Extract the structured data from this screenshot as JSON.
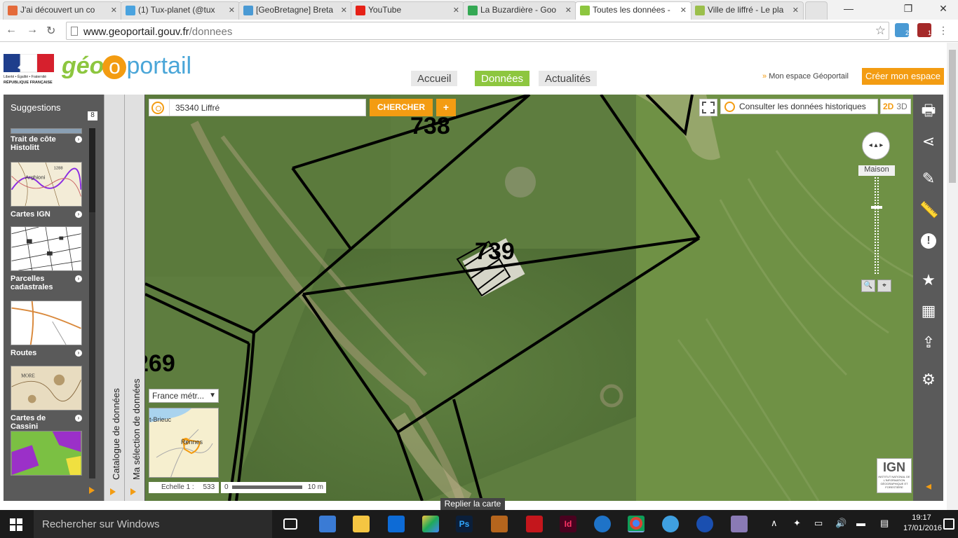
{
  "browser": {
    "tabs": [
      {
        "title": "J'ai découvert un co",
        "color": "#e46a3a"
      },
      {
        "title": "(1) Tux-planet (@tux",
        "color": "#4aa3df"
      },
      {
        "title": "[GeoBretagne] Breta",
        "color": "#4a9ad4"
      },
      {
        "title": "YouTube",
        "color": "#e62117"
      },
      {
        "title": "La Buzardière - Goo",
        "color": "#34a853"
      },
      {
        "title": "Toutes les données -",
        "color": "#8dc63f"
      },
      {
        "title": "Ville de liffré - Le pla",
        "color": "#9bbf4b"
      }
    ],
    "url_host": "www.geoportail.gouv.fr",
    "url_path": "/donnees",
    "window_minimize": "—",
    "window_maximize": "❐",
    "window_close": "✕",
    "close_tab": "✕",
    "back": "←",
    "forward": "→",
    "reload": "↻",
    "star": "☆",
    "extension_badges": [
      "2",
      "1"
    ]
  },
  "header": {
    "logo_geo": "géo",
    "logo_o": "o",
    "logo_portail": "portail",
    "rf_line1": "Liberté • Égalité • Fraternité",
    "rf_line2": "RÉPUBLIQUE FRANÇAISE",
    "nav": [
      "Accueil",
      "Données",
      "Actualités"
    ],
    "my_space": "Mon espace Géoportail",
    "my_space_arrow": "»",
    "create_space": "Créer mon espace"
  },
  "sidebar": {
    "title": "Suggestions",
    "count": "8",
    "items": [
      {
        "label": "Trait de côte Histolitt"
      },
      {
        "label": "Cartes IGN"
      },
      {
        "label": "Parcelles cadastrales"
      },
      {
        "label": "Routes"
      },
      {
        "label": "Cartes de Cassini"
      }
    ],
    "arrow": "›",
    "thumb_text": {
      "ign_1": "Arghioni",
      "ign_2": "1288",
      "cassini": "MORE"
    }
  },
  "vertical_tabs": {
    "catalog": "Catalogue de données",
    "selection": "Ma sélection de données"
  },
  "map": {
    "search_value": "35340 Liffré",
    "search_button": "CHERCHER",
    "plus_button": "+",
    "history_label": "Consulter les données historiques",
    "view_2d": "2D",
    "view_3d": "3D",
    "parcel_labels": [
      "738",
      "739",
      "269"
    ],
    "zoom_label": "Maison",
    "pan_glyph": "◂ ▴ ▸",
    "zoom_in_glyph": "🔍",
    "zoom_center_glyph": "⌖",
    "zoom_level": 0.3,
    "minimap_select": "France métr...",
    "minimap_select_caret": "▼",
    "minimap_labels": [
      "t-Brieuc",
      "Rennes"
    ],
    "scale_label": "Echelle 1 :",
    "scale_value": "533",
    "scale_zero": "0",
    "scale_end": "10 m",
    "ign_logo": "IGN",
    "ign_caption": "INSTITUT NATIONAL DE L'INFORMATION GÉOGRAPHIQUE ET FORESTIÈRE",
    "fold_label": "Replier la carte",
    "tools": [
      "print-icon",
      "share-icon",
      "pencil-icon",
      "ruler-icon",
      "alert-icon",
      "star-icon",
      "map-icon",
      "import-icon",
      "settings-icon"
    ],
    "tool_glyphs": [
      "🖶",
      "⋖",
      "✎",
      "📏",
      "!",
      "★",
      "▦",
      "⇪",
      "⚙"
    ],
    "toolbar_arrow": "◂"
  },
  "taskbar": {
    "search_placeholder": "Rechercher sur Windows",
    "ps_label": "Ps",
    "id_label": "Id",
    "time": "19:17",
    "date": "17/01/2016",
    "tray_glyphs": [
      "∧",
      "✦",
      "▭",
      "🔊",
      "▬",
      "▤"
    ]
  },
  "colors": {
    "accent": "#f39c12",
    "green": "#8dc63f"
  }
}
